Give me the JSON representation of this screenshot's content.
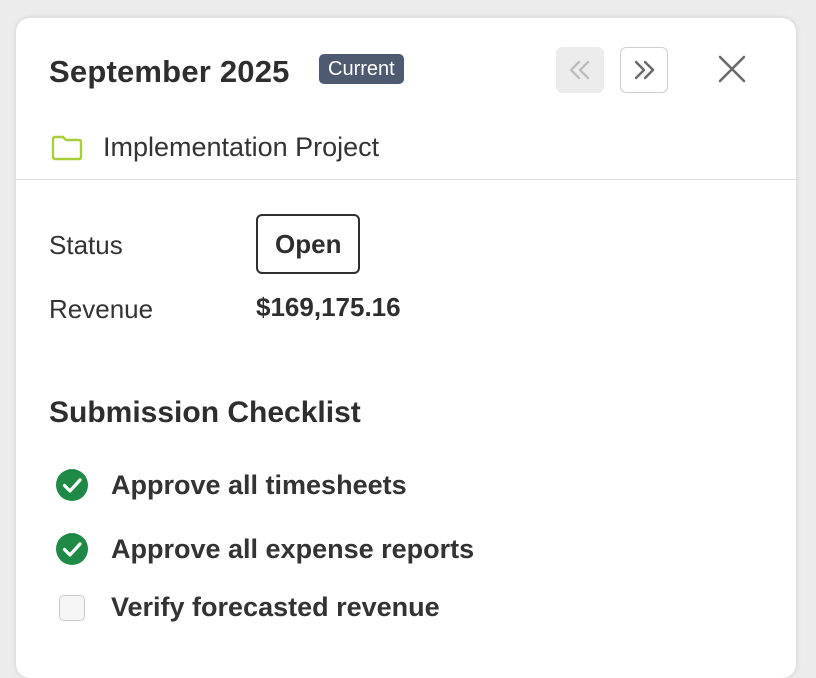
{
  "header": {
    "title": "September 2025",
    "badge": "Current",
    "project_name": "Implementation Project"
  },
  "icons": {
    "prev": "double-chevron-left-icon",
    "next": "double-chevron-right-icon",
    "close": "close-icon",
    "folder": "folder-icon",
    "checked": "check-circle-icon"
  },
  "colors": {
    "badge_bg": "#4d5a6f",
    "folder": "#a8cf3a",
    "check_green": "#1e8a45"
  },
  "fields": {
    "status_label": "Status",
    "status_value": "Open",
    "revenue_label": "Revenue",
    "revenue_value": "$169,175.16"
  },
  "checklist": {
    "title": "Submission Checklist",
    "items": [
      {
        "label": "Approve all timesheets",
        "checked": true
      },
      {
        "label": "Approve all expense reports",
        "checked": true
      },
      {
        "label": "Verify forecasted revenue",
        "checked": false
      }
    ]
  }
}
